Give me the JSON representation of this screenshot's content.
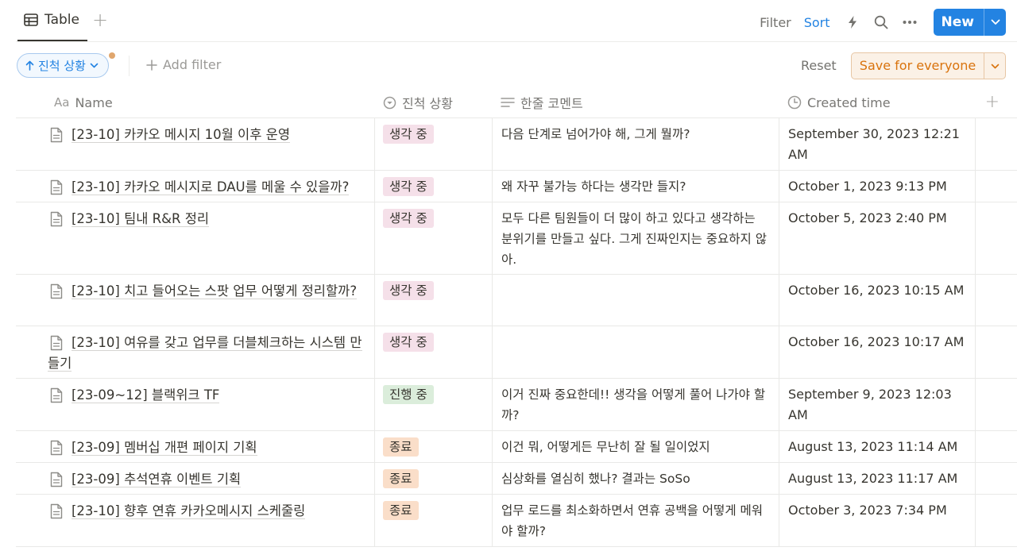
{
  "view": {
    "tab_label": "Table",
    "add_view_symbol": "+"
  },
  "toolbar": {
    "filter_label": "Filter",
    "sort_label": "Sort",
    "new_label": "New"
  },
  "filterbar": {
    "sort_pill_label": "진척 상황",
    "add_filter_label": "Add filter",
    "reset_label": "Reset",
    "save_label": "Save for everyone"
  },
  "columns": {
    "name": "Name",
    "name_prefix": "Aa",
    "status": "진척 상황",
    "comment": "한줄 코멘트",
    "created": "Created time"
  },
  "colors": {
    "accent": "#2383e2",
    "save_orange": "#d9730d",
    "tag_thinking": "#f5e0e9",
    "tag_progress": "#dbeddb",
    "tag_done": "#fadec9"
  },
  "rows": [
    {
      "name": "[23-10] 카카오 메시지 10월 이후 운영",
      "status": "생각 중",
      "status_color": "pink",
      "comment": "다음 단계로 넘어가야 해, 그게 뭘까?",
      "created": "September 30, 2023 12:21 AM"
    },
    {
      "name": "[23-10] 카카오 메시지로 DAU를 메울 수 있을까?",
      "status": "생각 중",
      "status_color": "pink",
      "comment": "왜 자꾸 불가능 하다는 생각만 들지?",
      "created": "October 1, 2023 9:13 PM"
    },
    {
      "name": "[23-10] 팀내 R&R 정리",
      "status": "생각 중",
      "status_color": "pink",
      "comment": "모두 다른 팀원들이 더 많이 하고 있다고 생각하는 분위기를 만들고 싶다. 그게 진짜인지는 중요하지 않아.",
      "created": "October 5, 2023 2:40 PM"
    },
    {
      "name": "[23-10] 치고 들어오는 스팟 업무 어떻게 정리할까?",
      "status": "생각 중",
      "status_color": "pink",
      "comment": "",
      "created": "October 16, 2023 10:15 AM"
    },
    {
      "name": "[23-10] 여유를 갖고 업무를 더블체크하는 시스템 만들기",
      "status": "생각 중",
      "status_color": "pink",
      "comment": "",
      "created": "October 16, 2023 10:17 AM"
    },
    {
      "name": "[23-09~12] 블랙위크 TF",
      "status": "진행 중",
      "status_color": "green",
      "comment": "이거 진짜 중요한데!! 생각을 어떻게 풀어 나가야 할까?",
      "created": "September 9, 2023 12:03 AM"
    },
    {
      "name": "[23-09] 멤버십 개편 페이지 기획",
      "status": "종료",
      "status_color": "orange",
      "comment": "이건 뭐, 어떻게든 무난히 잘 될 일이었지",
      "created": "August 13, 2023 11:14 AM"
    },
    {
      "name": "[23-09] 추석연휴 이벤트 기획",
      "status": "종료",
      "status_color": "orange",
      "comment": "심상화를 열심히 했나? 결과는 SoSo",
      "created": "August 13, 2023 11:17 AM"
    },
    {
      "name": "[23-10] 향후 연휴 카카오메시지 스케줄링",
      "status": "종료",
      "status_color": "orange",
      "comment": "업무 로드를 최소화하면서 연휴 공백을 어떻게 메워야 할까?",
      "created": "October 3, 2023 7:34 PM"
    }
  ]
}
